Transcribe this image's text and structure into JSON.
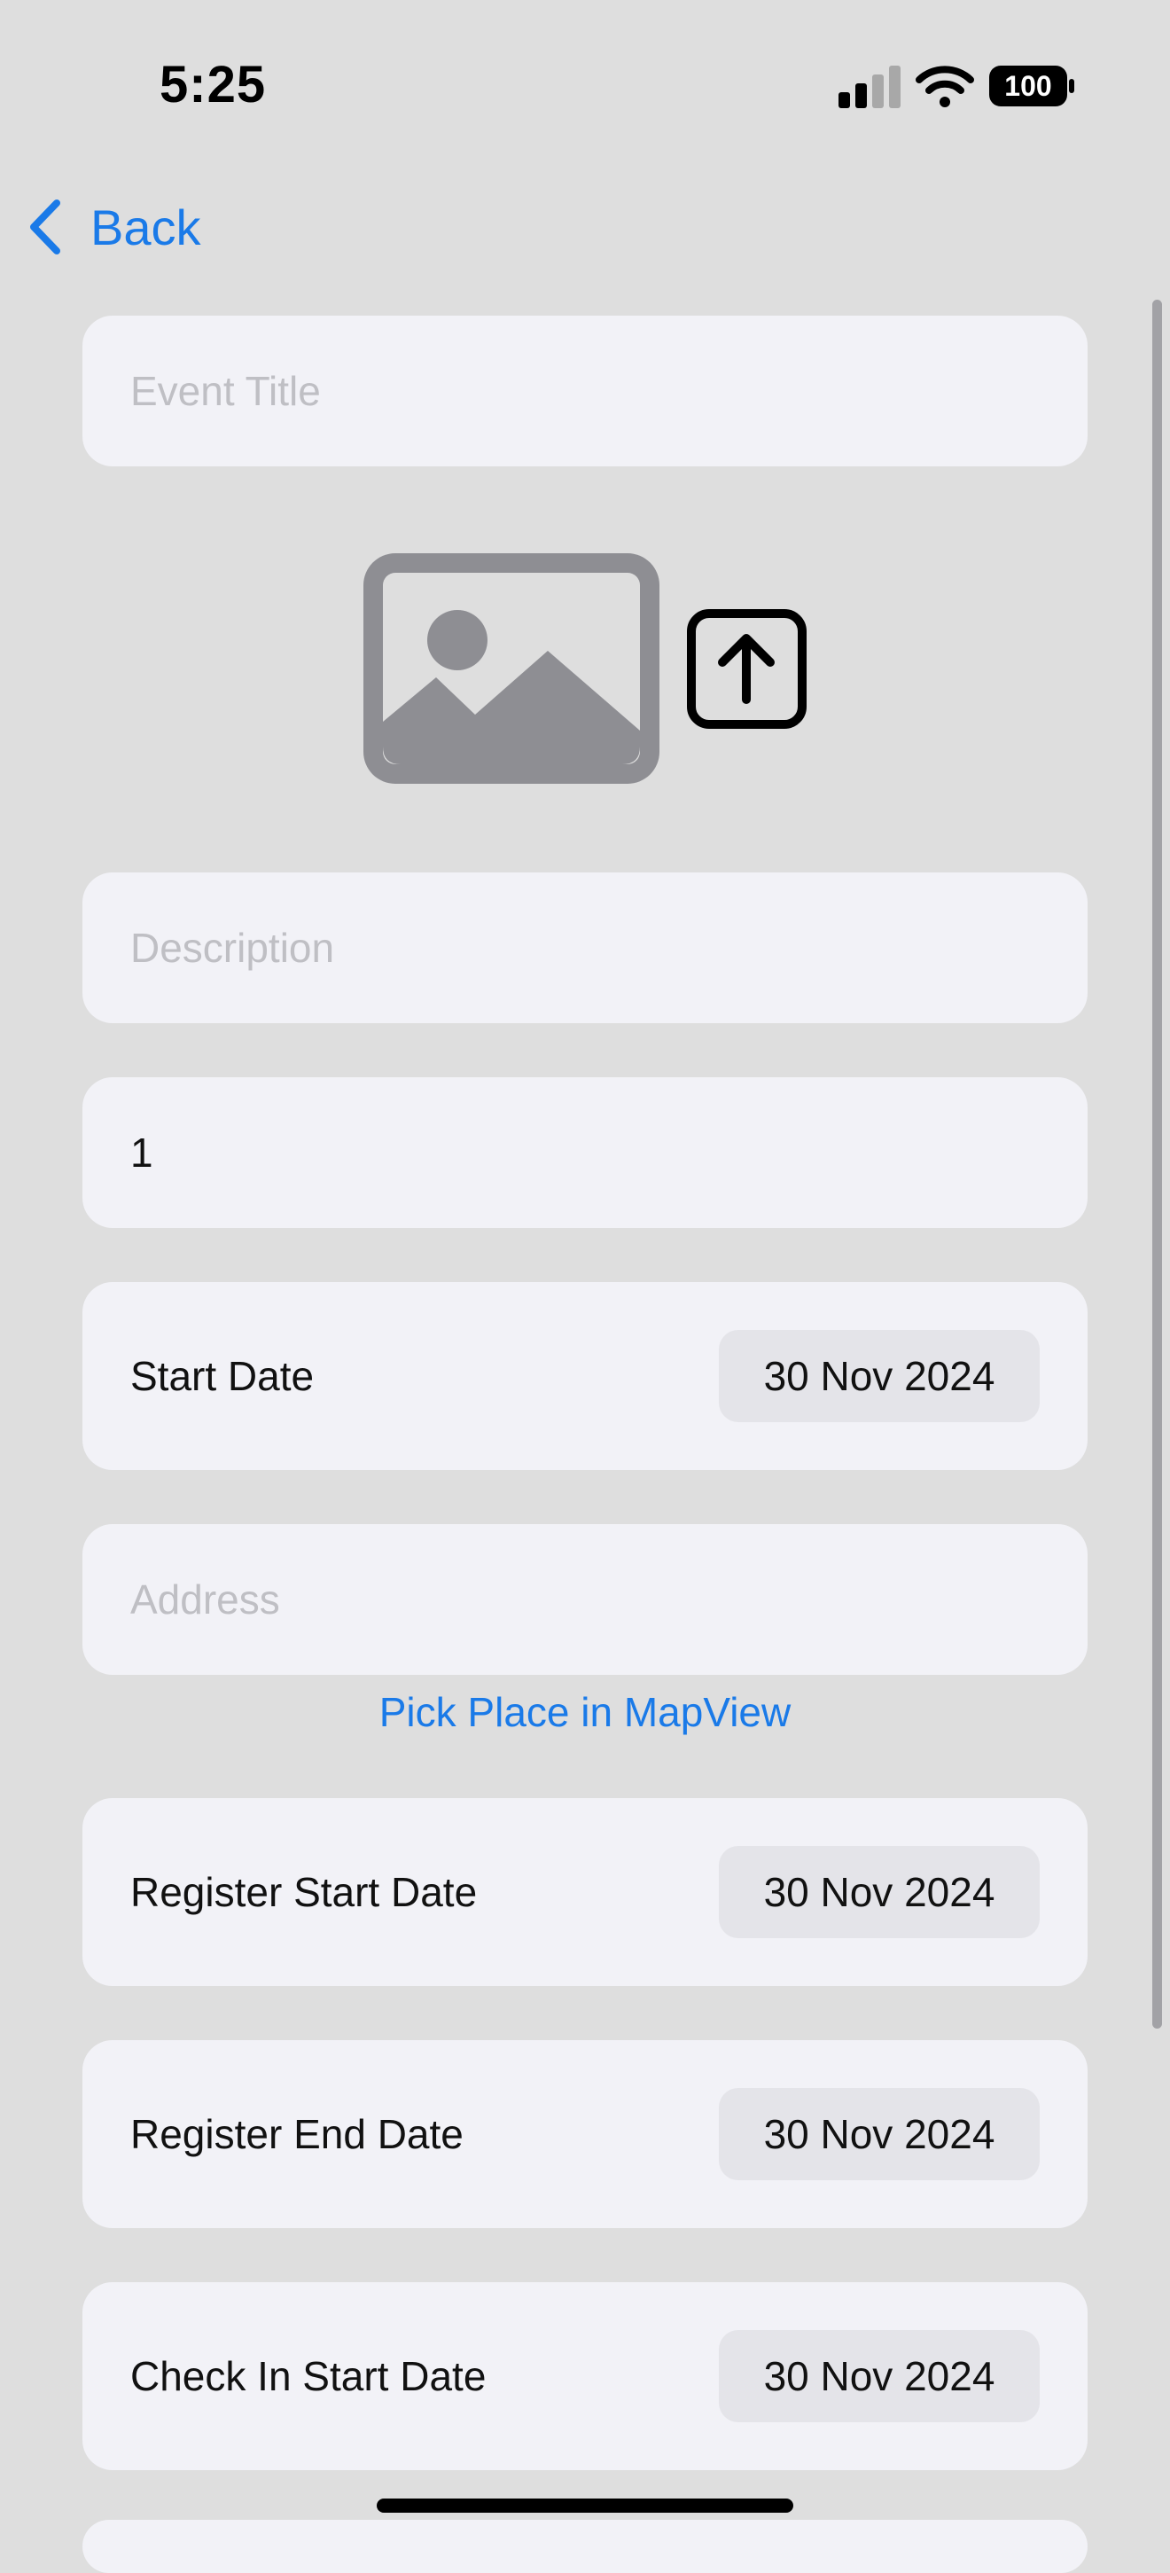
{
  "status_bar": {
    "time": "5:25",
    "battery_level": "100",
    "signal_icon": "cellular-signal-icon",
    "wifi_icon": "wifi-icon",
    "battery_icon": "battery-icon"
  },
  "nav": {
    "back_label": "Back",
    "back_icon": "chevron-left-icon",
    "accent_color": "#1a7ae8"
  },
  "form": {
    "event_title": {
      "placeholder": "Event Title",
      "value": ""
    },
    "image": {
      "photo_icon": "photo-placeholder-icon",
      "upload_icon": "upload-icon"
    },
    "description": {
      "placeholder": "Description",
      "value": ""
    },
    "quantity": {
      "value": "1"
    },
    "start_date": {
      "label": "Start Date",
      "value": "30 Nov 2024"
    },
    "address": {
      "placeholder": "Address",
      "value": ""
    },
    "map_link": "Pick Place in MapView",
    "register_start": {
      "label": "Register Start Date",
      "value": "30 Nov 2024"
    },
    "register_end": {
      "label": "Register End Date",
      "value": "30 Nov 2024"
    },
    "checkin_start": {
      "label": "Check In Start Date",
      "value": "30 Nov 2024"
    }
  }
}
